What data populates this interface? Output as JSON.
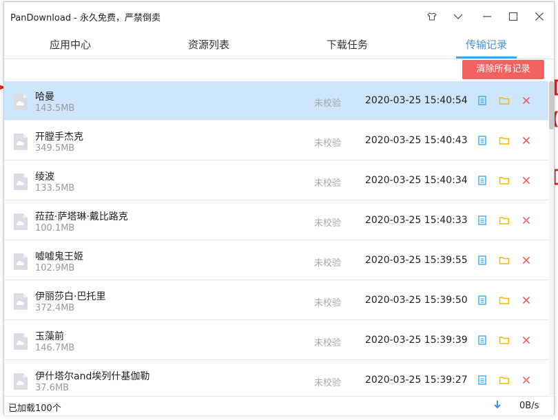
{
  "window": {
    "title": "PanDownload - 永久免费，严禁倒卖"
  },
  "titlebar_icons": [
    "shirt-icon",
    "chevron-down-icon",
    "minimize-icon",
    "maximize-icon",
    "close-icon"
  ],
  "tabs": [
    {
      "label": "应用中心",
      "active": false
    },
    {
      "label": "资源列表",
      "active": false
    },
    {
      "label": "下载任务",
      "active": false
    },
    {
      "label": "传输记录",
      "active": true
    }
  ],
  "toolbar": {
    "clear_all_label": "清除所有记录"
  },
  "records": [
    {
      "name": "哈曼",
      "size": "143.5MB",
      "status": "未校验",
      "time": "2020-03-25 15:40:54",
      "selected": true
    },
    {
      "name": "开膛手杰克",
      "size": "349.5MB",
      "status": "未校验",
      "time": "2020-03-25 15:40:43",
      "selected": false
    },
    {
      "name": "绫波",
      "size": "133.5MB",
      "status": "未校验",
      "time": "2020-03-25 15:40:34",
      "selected": false
    },
    {
      "name": "菈菈·萨塔琳·戴比路克",
      "size": "100.1MB",
      "status": "未校验",
      "time": "2020-03-25 15:40:33",
      "selected": false
    },
    {
      "name": "嘘嘘鬼王姬",
      "size": "102.9MB",
      "status": "未校验",
      "time": "2020-03-25 15:39:55",
      "selected": false
    },
    {
      "name": "伊丽莎白·巴托里",
      "size": "372.4MB",
      "status": "未校验",
      "time": "2020-03-25 15:39:50",
      "selected": false
    },
    {
      "name": "玉藻前",
      "size": "146.7MB",
      "status": "未校验",
      "time": "2020-03-25 15:39:39",
      "selected": false
    },
    {
      "name": "伊什塔尔and埃列什基伽勒",
      "size": "37.6MB",
      "status": "未校验",
      "time": "2020-03-25 15:39:27",
      "selected": false
    }
  ],
  "statusbar": {
    "loaded_text": "已加载100个",
    "speed": "0B/s"
  },
  "colors": {
    "accent": "#4a9fe8",
    "danger": "#f4625f",
    "selected_row": "#cde6fb",
    "folder": "#f5b800"
  }
}
